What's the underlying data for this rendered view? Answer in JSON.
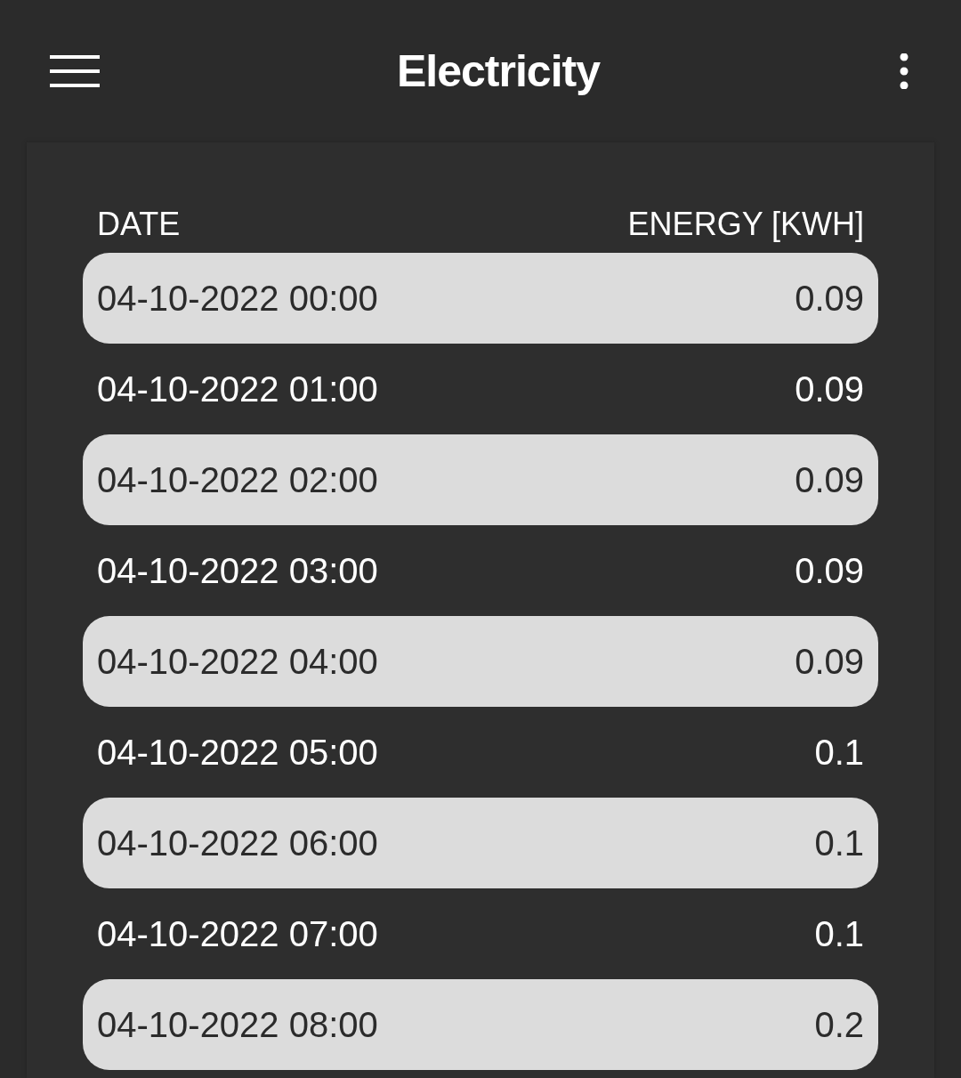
{
  "app_bar": {
    "title": "Electricity"
  },
  "table": {
    "columns": [
      "DATE",
      "ENERGY [KWH]"
    ],
    "rows": [
      {
        "date": "04-10-2022 00:00",
        "energy": "0.09"
      },
      {
        "date": "04-10-2022 01:00",
        "energy": "0.09"
      },
      {
        "date": "04-10-2022 02:00",
        "energy": "0.09"
      },
      {
        "date": "04-10-2022 03:00",
        "energy": "0.09"
      },
      {
        "date": "04-10-2022 04:00",
        "energy": "0.09"
      },
      {
        "date": "04-10-2022 05:00",
        "energy": "0.1"
      },
      {
        "date": "04-10-2022 06:00",
        "energy": "0.1"
      },
      {
        "date": "04-10-2022 07:00",
        "energy": "0.1"
      },
      {
        "date": "04-10-2022 08:00",
        "energy": "0.2"
      }
    ]
  }
}
